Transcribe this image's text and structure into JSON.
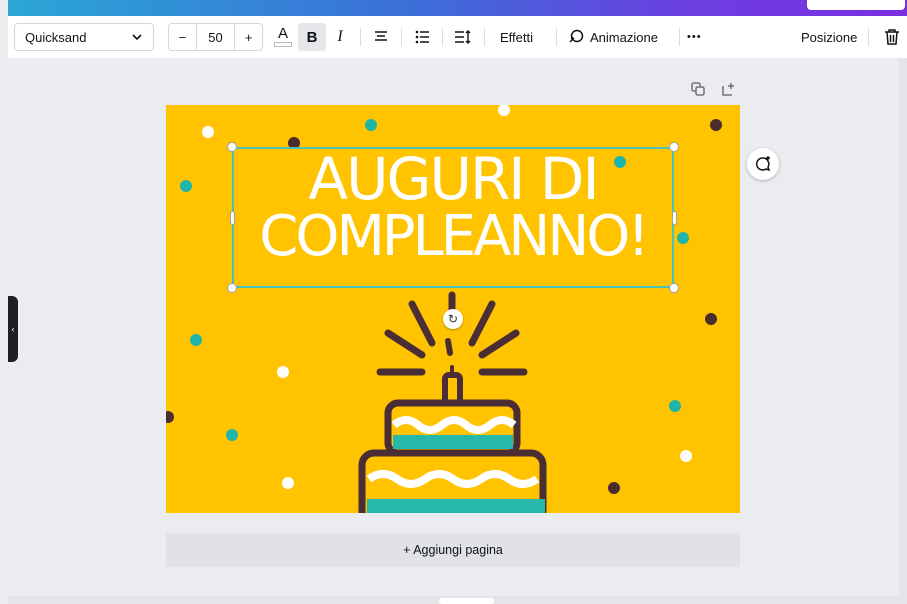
{
  "toolbar": {
    "font_family": "Quicksand",
    "font_size": "50",
    "decrease_label": "−",
    "increase_label": "+",
    "text_color_label": "A",
    "bold_label": "B",
    "italic_label": "I",
    "effects_label": "Effetti",
    "animation_label": "Animazione",
    "more_label": "•••",
    "position_label": "Posizione"
  },
  "canvas": {
    "title_line1": "AUGURI DI",
    "title_line2": "COMPLEANNO!",
    "add_page_label": "+ Aggiungi pagina",
    "background_color": "#ffc300",
    "selection_color": "#4bc1b4"
  },
  "colors": {
    "dot_white": "#ffffff",
    "dot_teal": "#1fb5a8",
    "dot_dark": "#4a2d2d",
    "cake_outline": "#4a2d35",
    "cake_teal": "#26b9aa"
  },
  "icons": [
    "chevron-down-icon",
    "text-color-icon",
    "bold-icon",
    "italic-icon",
    "align-center-icon",
    "list-icon",
    "line-spacing-icon",
    "effects-icon",
    "more-icon",
    "trash-icon",
    "duplicate-icon",
    "add-page-icon",
    "comment-add-icon",
    "rotate-icon",
    "collapse-panel-icon"
  ]
}
